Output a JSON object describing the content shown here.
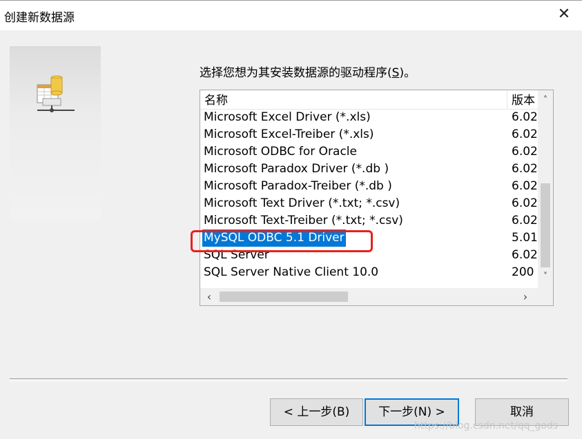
{
  "window": {
    "title": "创建新数据源",
    "close_glyph": "✕"
  },
  "prompt": {
    "text_before": "选择您想为其安装数据源的驱动程序(",
    "mnemonic": "S",
    "text_after": ")。"
  },
  "list": {
    "columns": [
      "名称",
      "版本"
    ],
    "rows": [
      {
        "name": "Microsoft Excel Driver (*.xls)",
        "version": "6.02"
      },
      {
        "name": "Microsoft Excel-Treiber (*.xls)",
        "version": "6.02"
      },
      {
        "name": "Microsoft ODBC for Oracle",
        "version": "6.02"
      },
      {
        "name": "Microsoft Paradox Driver (*.db )",
        "version": "6.02"
      },
      {
        "name": "Microsoft Paradox-Treiber (*.db )",
        "version": "6.02"
      },
      {
        "name": "Microsoft Text Driver (*.txt; *.csv)",
        "version": "6.02"
      },
      {
        "name": "Microsoft Text-Treiber (*.txt; *.csv)",
        "version": "6.02"
      },
      {
        "name": "MySQL ODBC 5.1 Driver",
        "version": "5.01",
        "selected": true
      },
      {
        "name": "SQL Server",
        "version": "6.02"
      },
      {
        "name": "SQL Server Native Client 10.0",
        "version": "200"
      }
    ],
    "scroll_icons": {
      "up": "chevron-up-icon",
      "down": "chevron-down-icon",
      "left": "chevron-left-icon",
      "right": "chevron-right-icon"
    }
  },
  "buttons": {
    "back": "< 上一步(B)",
    "next": "下一步(N) >",
    "cancel": "取消"
  },
  "watermark": "https://blog.csdn.net/qq_gods",
  "colors": {
    "selection": "#0078d7",
    "highlight_box": "#e8201c",
    "dialog_bg": "#f0f0f0"
  }
}
